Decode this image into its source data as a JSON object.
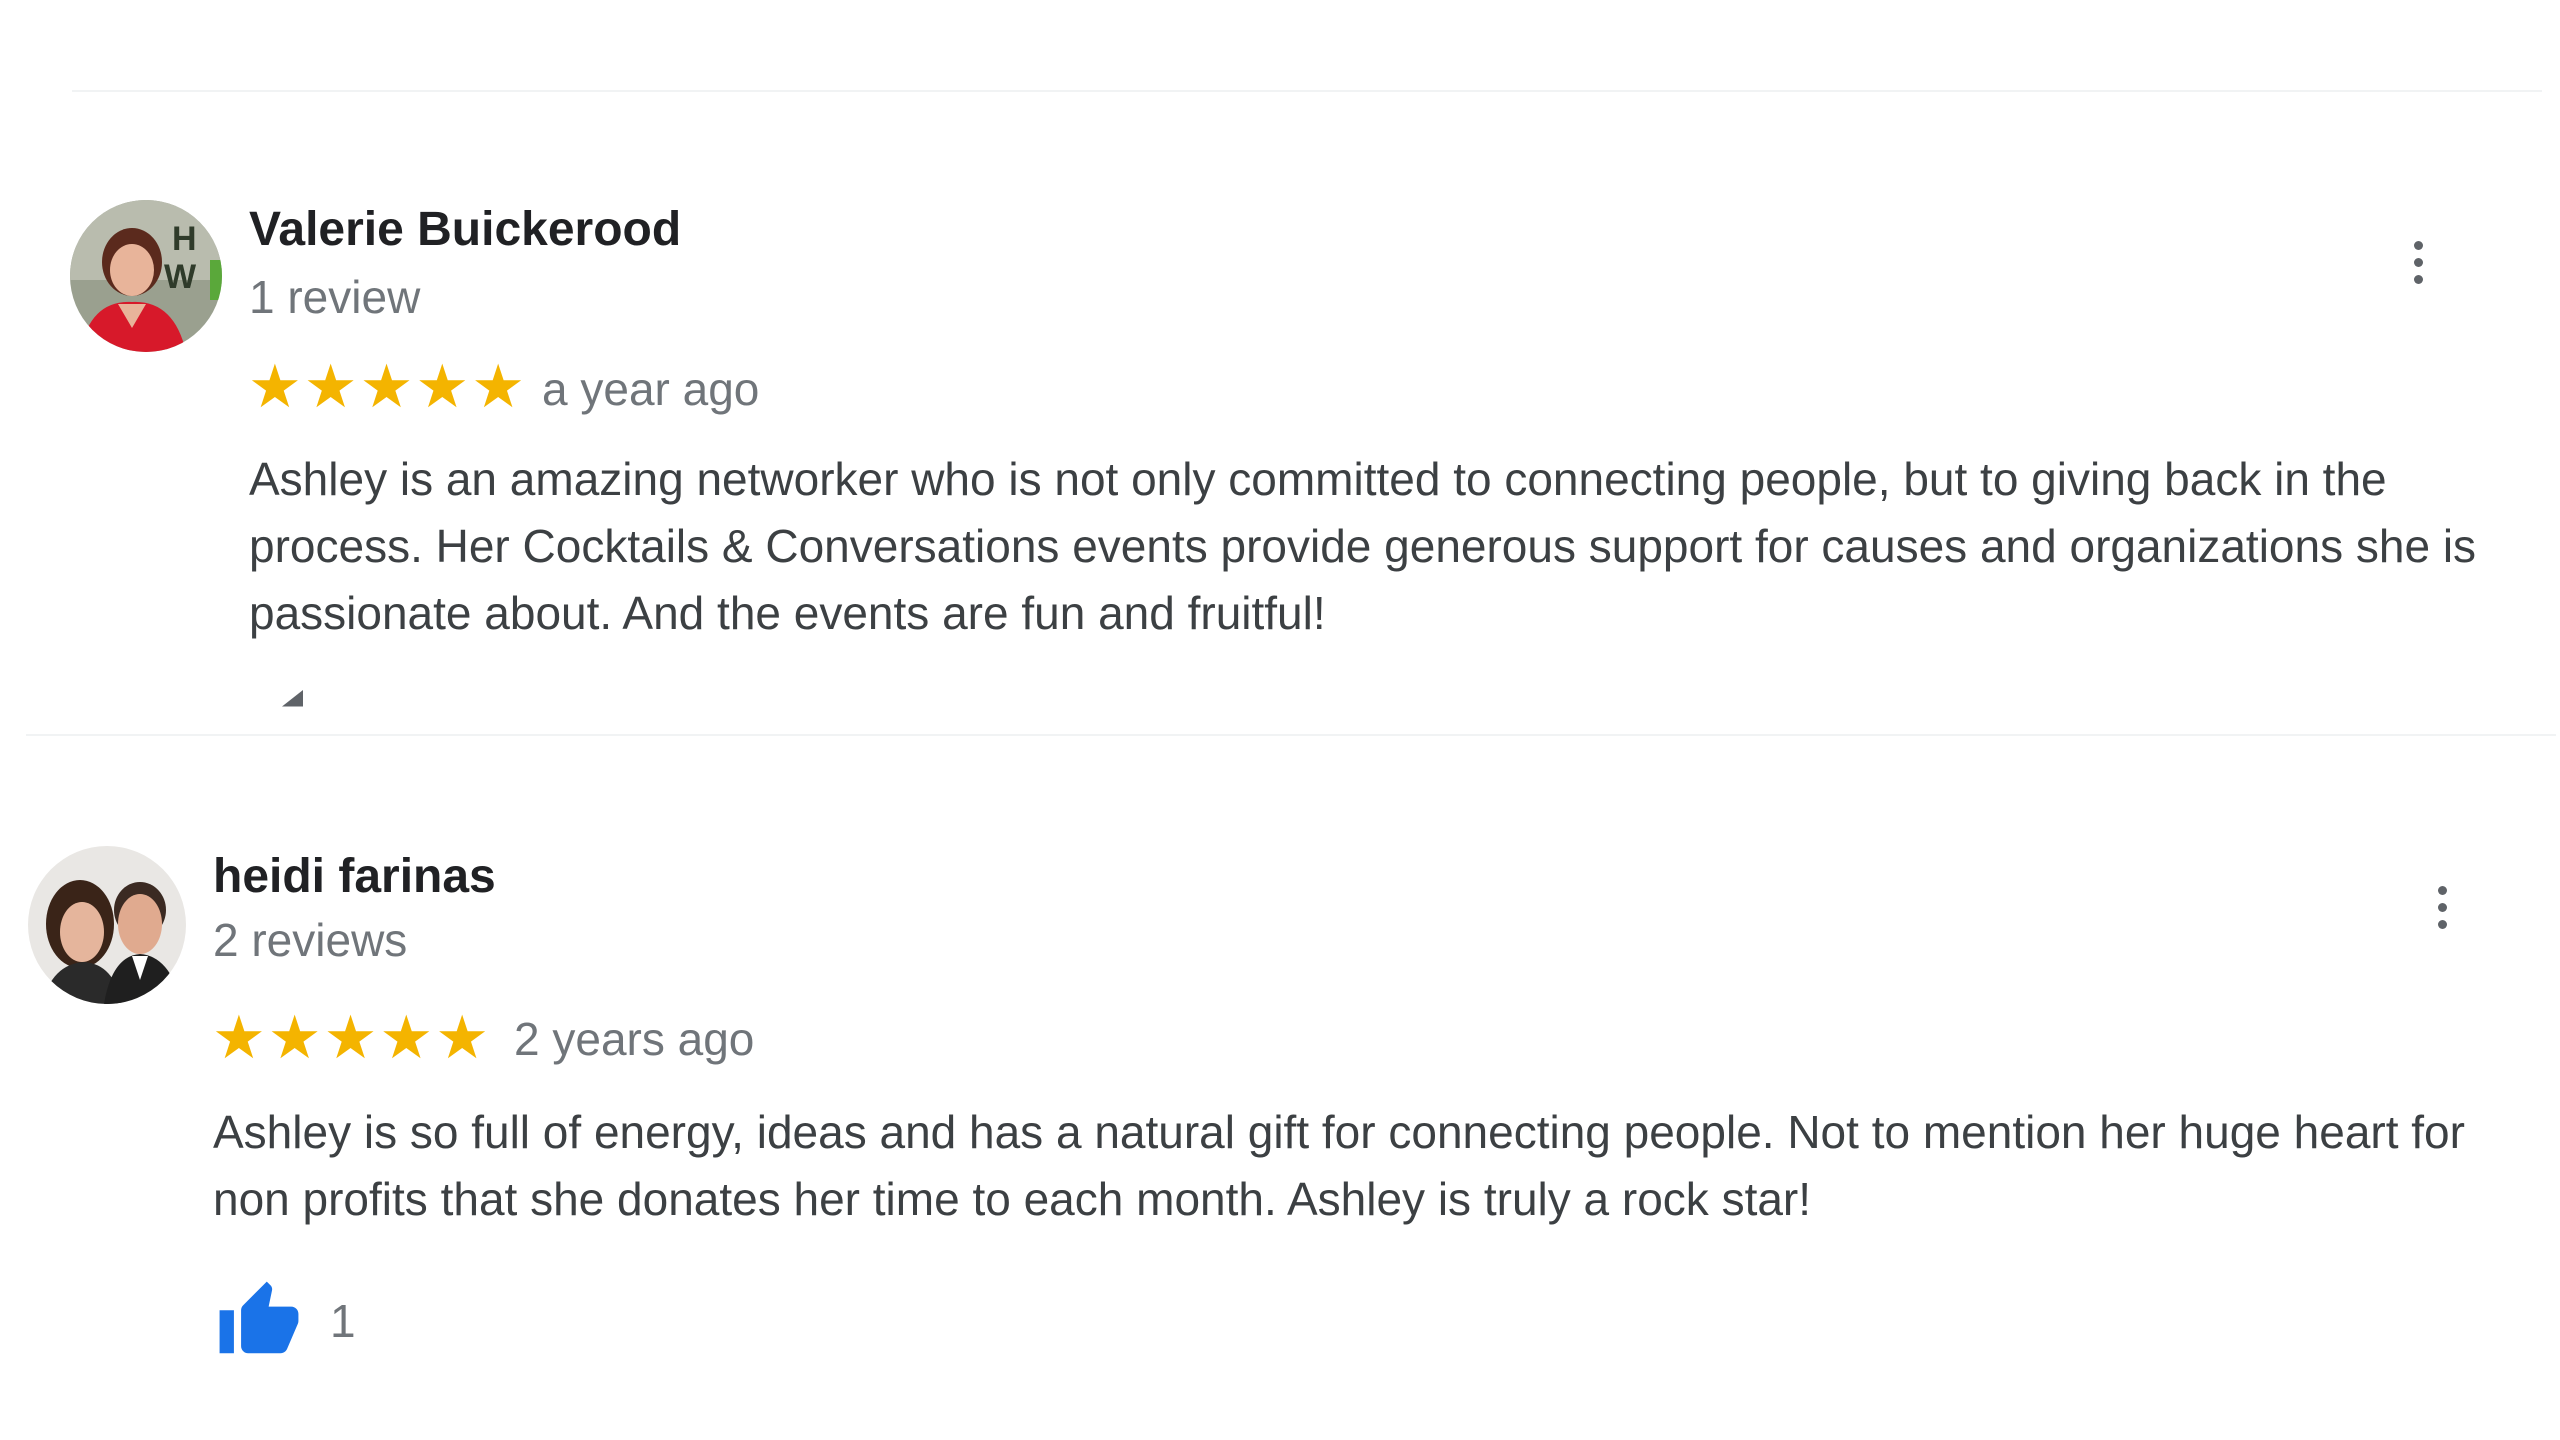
{
  "reviews": [
    {
      "author": "Valerie Buickerood",
      "review_count": "1 review",
      "rating": 5,
      "stars": "★★★★★",
      "date": "a year ago",
      "text": "Ashley is an amazing networker who is not only committed to connecting people, but to giving back in the process.  Her Cocktails & Conversations events provide generous support for causes and organizations she is passionate about.  And the events are fun and fruitful!",
      "avatar_badge": "H WO"
    },
    {
      "author": "heidi farinas",
      "review_count": "2 reviews",
      "rating": 5,
      "stars": "★★★★★",
      "date": "2 years ago",
      "text": "Ashley is so full of energy, ideas and has a natural gift for connecting people. Not to mention her huge heart for non profits that she donates her time to each month. Ashley is truly a rock star!",
      "likes": "1"
    }
  ],
  "icons": {
    "more": "more-vert-icon",
    "like": "thumbs-up-icon",
    "share": "share-icon"
  },
  "colors": {
    "star": "#f4b400",
    "like": "#1a73e8",
    "name": "#202124",
    "meta": "#70757a",
    "text": "#3c4043"
  }
}
